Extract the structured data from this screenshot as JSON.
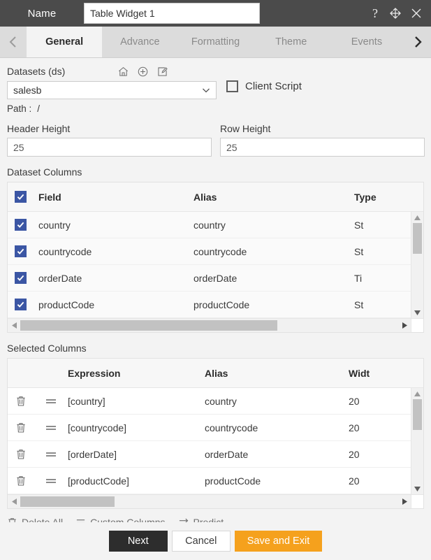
{
  "titlebar": {
    "name_label": "Name",
    "widget_name": "Table Widget 1",
    "help_icon": "question-mark-icon",
    "move_icon": "move-cross-icon",
    "close_icon": "close-icon"
  },
  "tabbar": {
    "prev_icon": "chevron-left-icon",
    "next_icon": "chevron-right-icon",
    "tabs": [
      {
        "label": "General",
        "active": true
      },
      {
        "label": "Advance",
        "active": false
      },
      {
        "label": "Formatting",
        "active": false
      },
      {
        "label": "Theme",
        "active": false
      },
      {
        "label": "Events",
        "active": false
      }
    ]
  },
  "datasets": {
    "label": "Datasets (ds)",
    "home_icon": "home-icon",
    "add_icon": "plus-circle-icon",
    "edit_icon": "edit-pencil-icon",
    "selected_value": "salesb",
    "dropdown_icon": "chevron-down-icon",
    "path_label": "Path :",
    "path_value": "/"
  },
  "client_script": {
    "label": "Client Script",
    "checked": false
  },
  "header_height": {
    "label": "Header Height",
    "value": "25"
  },
  "row_height": {
    "label": "Row Height",
    "value": "25"
  },
  "dataset_columns": {
    "title": "Dataset Columns",
    "header": {
      "select_all_checked": true,
      "field": "Field",
      "alias": "Alias",
      "type": "Type"
    },
    "rows": [
      {
        "checked": true,
        "field": "country",
        "alias": "country",
        "type": "St"
      },
      {
        "checked": true,
        "field": "countrycode",
        "alias": "countrycode",
        "type": "St"
      },
      {
        "checked": true,
        "field": "orderDate",
        "alias": "orderDate",
        "type": "Ti"
      },
      {
        "checked": true,
        "field": "productCode",
        "alias": "productCode",
        "type": "St"
      }
    ]
  },
  "selected_columns": {
    "title": "Selected Columns",
    "header": {
      "expression": "Expression",
      "alias": "Alias",
      "width": "Widt"
    },
    "rows": [
      {
        "delete_icon": "trash-icon",
        "drag_icon": "drag-handle-icon",
        "expression": "[country]",
        "alias": "country",
        "width": "20"
      },
      {
        "delete_icon": "trash-icon",
        "drag_icon": "drag-handle-icon",
        "expression": "[countrycode]",
        "alias": "countrycode",
        "width": "20"
      },
      {
        "delete_icon": "trash-icon",
        "drag_icon": "drag-handle-icon",
        "expression": "[orderDate]",
        "alias": "orderDate",
        "width": "20"
      },
      {
        "delete_icon": "trash-icon",
        "drag_icon": "drag-handle-icon",
        "expression": "[productCode]",
        "alias": "productCode",
        "width": "20"
      }
    ]
  },
  "tools": {
    "delete_all": "Delete All",
    "delete_all_icon": "trash-icon",
    "custom_columns": "Custom Columns",
    "custom_columns_icon": "list-lines-icon",
    "predict": "Predict",
    "predict_icon": "swap-arrows-icon"
  },
  "buttons": {
    "next": "Next",
    "cancel": "Cancel",
    "save_and_exit": "Save and Exit"
  },
  "colors": {
    "titlebar_bg": "#4b4b4b",
    "tabbar_bg": "#dcdcdc",
    "body_bg": "#f3f3f3",
    "checkbox_blue": "#3b56a4",
    "save_orange": "#f5a11d",
    "next_dark": "#2d2d2d"
  }
}
